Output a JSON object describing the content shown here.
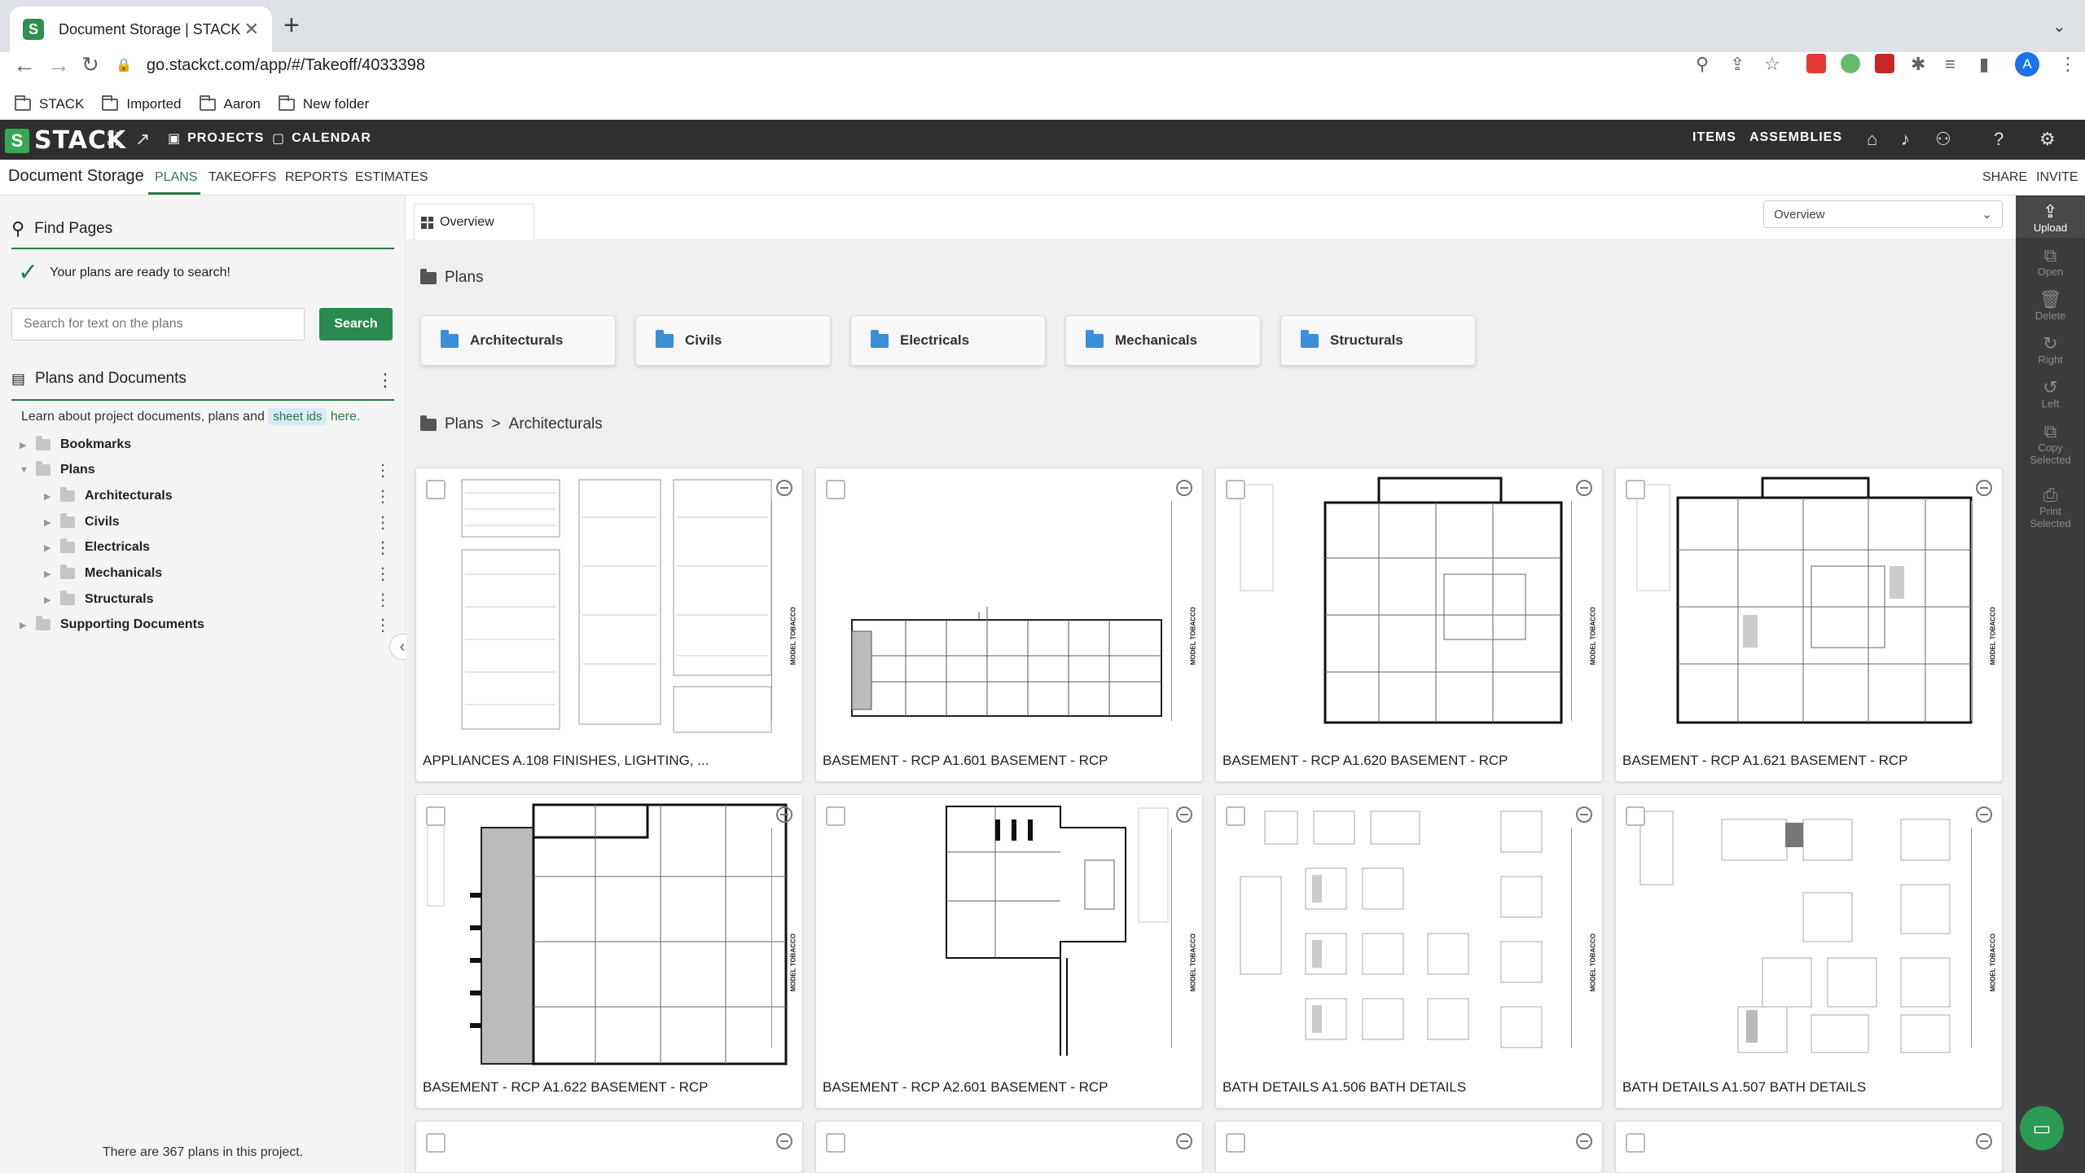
{
  "browser": {
    "tab_title": "Document Storage | STACK",
    "url": "go.stackct.com/app/#/Takeoff/4033398",
    "avatar_letter": "A",
    "bookmarks": [
      "STACK",
      "Imported",
      "Aaron",
      "New folder"
    ]
  },
  "appbar": {
    "logo": "STACK",
    "projects": "PROJECTS",
    "calendar": "CALENDAR",
    "items": "ITEMS",
    "assemblies": "ASSEMBLIES"
  },
  "subnav": {
    "title": "Document Storage",
    "tabs": [
      "PLANS",
      "TAKEOFFS",
      "REPORTS",
      "ESTIMATES"
    ],
    "share": "SHARE",
    "invite": "INVITE"
  },
  "left": {
    "find_pages": "Find Pages",
    "ready": "Your plans are ready to search!",
    "search_placeholder": "Search for text on the plans",
    "search_button": "Search",
    "plans_docs": "Plans and Documents",
    "learn_prefix": "Learn about project documents, plans and",
    "sheet_ids": "sheet ids",
    "here": "here.",
    "tree": [
      {
        "label": "Bookmarks",
        "level": 0
      },
      {
        "label": "Plans",
        "level": 0
      },
      {
        "label": "Architecturals",
        "level": 1
      },
      {
        "label": "Civils",
        "level": 1
      },
      {
        "label": "Electricals",
        "level": 1
      },
      {
        "label": "Mechanicals",
        "level": 1
      },
      {
        "label": "Structurals",
        "level": 1
      },
      {
        "label": "Supporting Documents",
        "level": 0
      }
    ],
    "plan_count": "There are 367 plans in this project."
  },
  "main": {
    "overview_tab": "Overview",
    "view_select": "Overview",
    "plans_crumb": "Plans",
    "crumb_sep": ">",
    "crumb_current": "Architecturals",
    "folders": [
      "Architecturals",
      "Civils",
      "Electricals",
      "Mechanicals",
      "Structurals"
    ],
    "sheet_brand": "MODEL TOBACCO",
    "cards": [
      "APPLIANCES A.108 FINISHES, LIGHTING, ...",
      "BASEMENT - RCP A1.601 BASEMENT - RCP",
      "BASEMENT - RCP A1.620 BASEMENT - RCP",
      "BASEMENT - RCP A1.621 BASEMENT - RCP",
      "BASEMENT - RCP A1.622 BASEMENT - RCP",
      "BASEMENT - RCP A2.601 BASEMENT - RCP",
      "BATH DETAILS A1.506 BATH DETAILS",
      "BATH DETAILS A1.507 BATH DETAILS"
    ]
  },
  "rail": {
    "upload": "Upload",
    "open": "Open",
    "delete": "Delete",
    "right": "Right",
    "left": "Left",
    "copy": "Copy",
    "copy_selected": "Selected",
    "print": "Print",
    "print_selected": "Selected"
  },
  "colors": {
    "accent": "#2a7a48",
    "folder_blue": "#3a8fd8",
    "appbar": "#2d2f31"
  }
}
